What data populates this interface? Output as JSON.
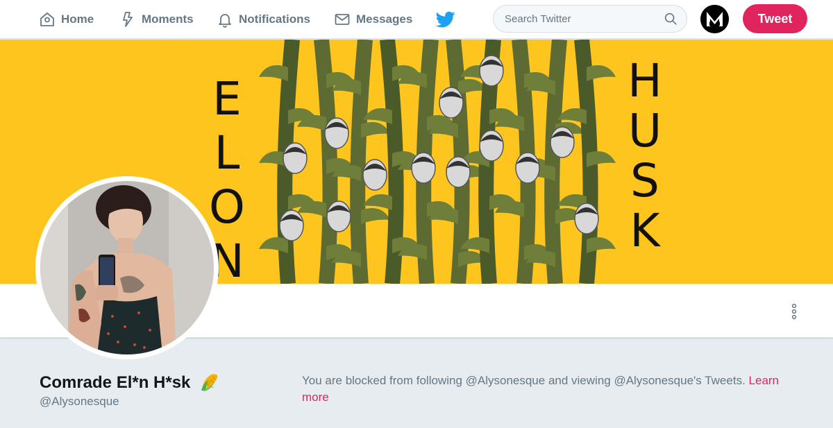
{
  "nav": {
    "home": "Home",
    "moments": "Moments",
    "notifications": "Notifications",
    "messages": "Messages"
  },
  "search": {
    "placeholder": "Search Twitter"
  },
  "tweet_button": "Tweet",
  "banner": {
    "left_text": "ELON",
    "right_text": "HUSK",
    "background_color": "#fec51e"
  },
  "profile": {
    "display_name": "Comrade El*n H*sk",
    "name_emoji": "corn-icon",
    "handle": "@Alysonesque"
  },
  "blocked_notice": {
    "text": "You are blocked from following @Alysonesque and viewing @Alysonesque's Tweets.",
    "link": "Learn more"
  },
  "colors": {
    "accent": "#e0245e",
    "twitter_blue": "#1da1f2",
    "nav_gray": "#657786"
  }
}
